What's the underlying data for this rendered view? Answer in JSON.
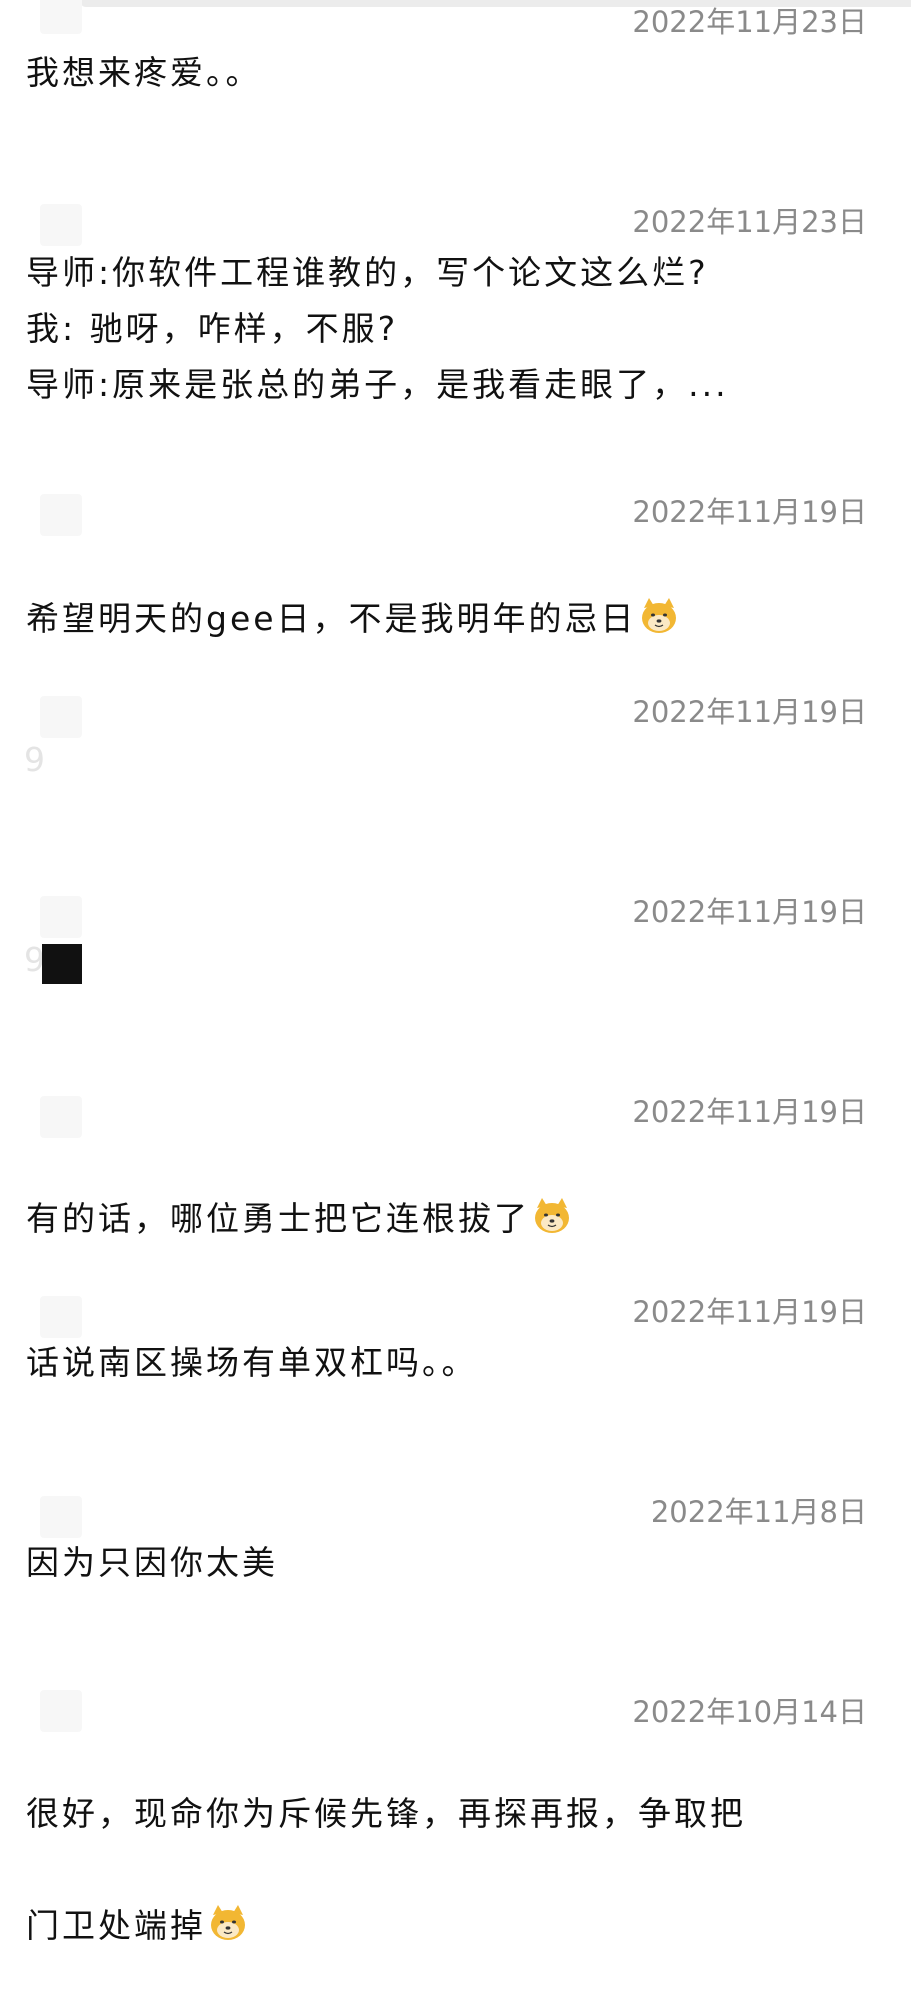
{
  "posts": [
    {
      "date": "2022年11月23日",
      "content": "我想来疼爱。。",
      "emoji": false
    },
    {
      "date": "2022年11月23日",
      "content": "导师:你软件工程谁教的，写个论文这么烂?\n我:  驰呀，咋样，不服?\n导师:原来是张总的弟子，是我看走眼了，...",
      "emoji": false
    },
    {
      "date": "2022年11月19日",
      "content": "希望明天的gee日，不是我明年的忌日",
      "emoji": true
    },
    {
      "date": "2022年11月19日",
      "content": "",
      "emoji": false
    },
    {
      "date": "2022年11月19日",
      "content": "",
      "emoji": false
    },
    {
      "date": "2022年11月19日",
      "content": "有的话，哪位勇士把它连根拔了",
      "emoji": true
    },
    {
      "date": "2022年11月19日",
      "content": "话说南区操场有单双杠吗。。",
      "emoji": false
    },
    {
      "date": "2022年11月8日",
      "content": "因为只因你太美",
      "emoji": false
    },
    {
      "date": "2022年10月14日",
      "content_line1": "很好，现命你为斥候先锋，再探再报，争取把",
      "content_line2": "门卫处端掉",
      "emoji": true
    }
  ],
  "icons": {
    "emoji": "doge-emoji-icon"
  },
  "colors": {
    "date": "#8a8a8a",
    "text": "#111111",
    "background": "#ffffff"
  }
}
